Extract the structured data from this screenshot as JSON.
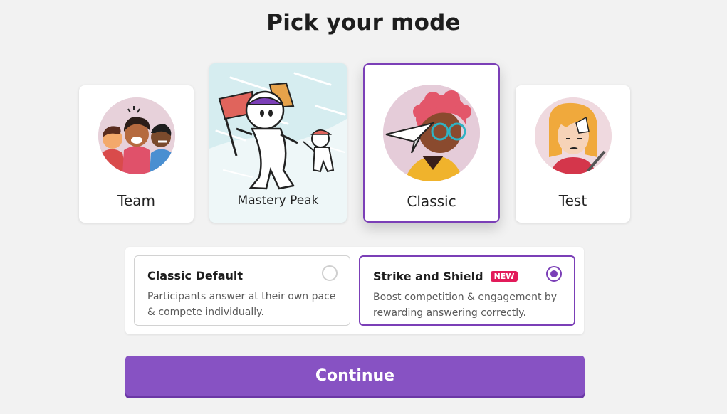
{
  "header": {
    "title": "Pick your mode"
  },
  "modes": [
    {
      "id": "team",
      "label": "Team"
    },
    {
      "id": "mastery",
      "label": "Mastery Peak"
    },
    {
      "id": "classic",
      "label": "Classic",
      "selected": true
    },
    {
      "id": "test",
      "label": "Test"
    }
  ],
  "options": [
    {
      "title": "Classic Default",
      "description": "Participants answer at their own pace & compete individually.",
      "selected": false
    },
    {
      "title": "Strike and Shield",
      "badge": "NEW",
      "description": "Boost competition & engagement by rewarding answering correctly.",
      "selected": true
    }
  ],
  "actions": {
    "continue_label": "Continue"
  },
  "colors": {
    "accent": "#7b3fb7",
    "button": "#8752c3",
    "badge": "#e21b5a",
    "background": "#f2f2f2"
  }
}
